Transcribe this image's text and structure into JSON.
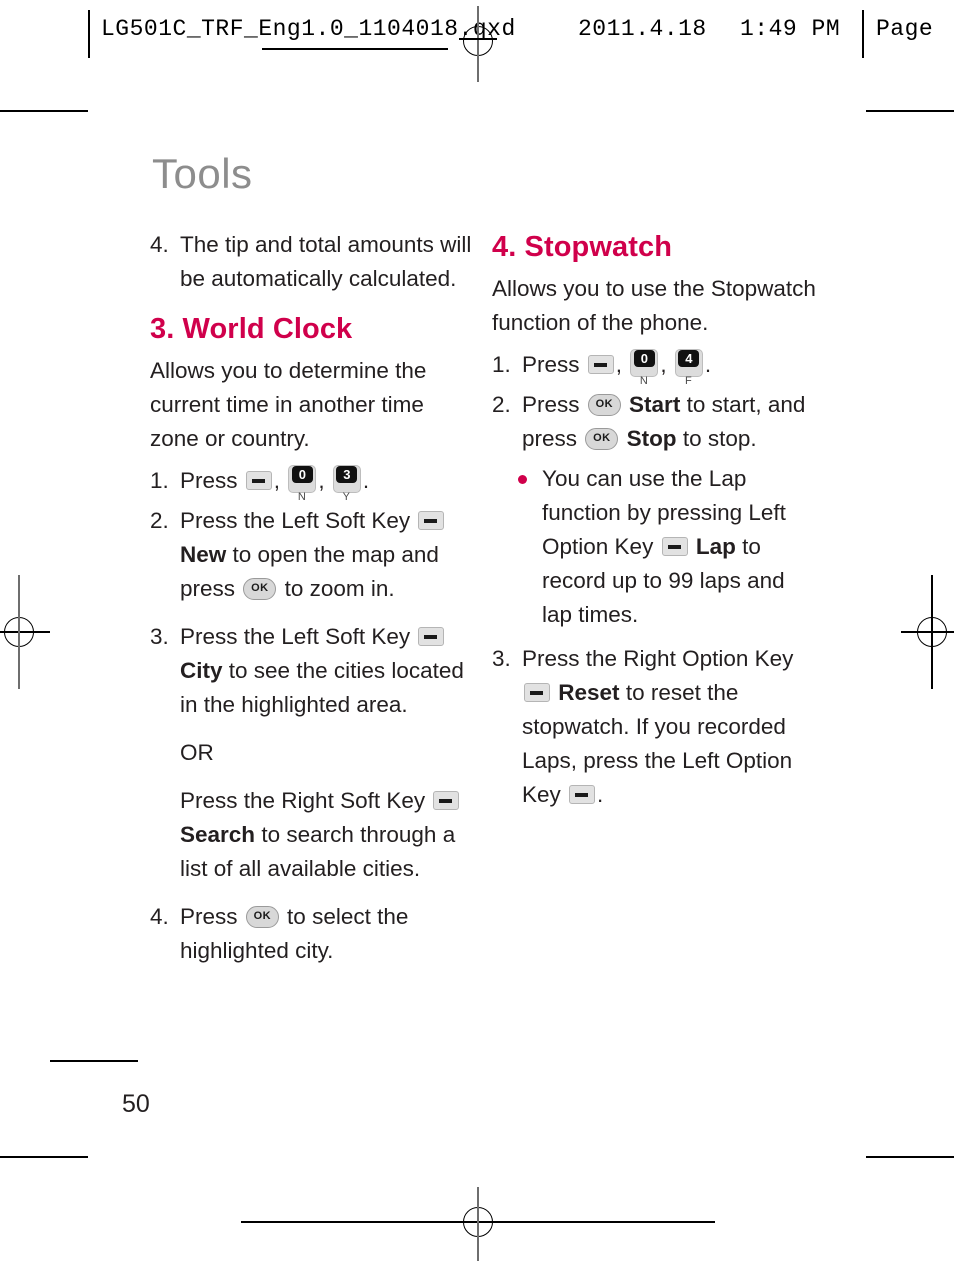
{
  "print_header": {
    "file": "LG501C_TRF_Eng1.0_1104018.qxd",
    "date": "2011.4.18",
    "time": "1:49 PM",
    "page_label": "Page"
  },
  "page": {
    "title": "Tools",
    "number": "50",
    "accent_color": "#d0004b",
    "title_color": "#8d8d8d"
  },
  "left_column": {
    "carryover_step": {
      "num": "4.",
      "text": "The tip and total amounts will be automatically calculated."
    },
    "section": {
      "heading": "3. World Clock",
      "intro": "Allows you to determine the current time in another time zone or country.",
      "steps": [
        {
          "num": "1.",
          "pre": "Press",
          "keys": [
            "soft-key-icon",
            "key-0-N-icon",
            "key-3-Y-icon"
          ],
          "post": "."
        },
        {
          "num": "2.",
          "pre": "Press the Left Soft Key",
          "key": "soft-key-icon",
          "bold": "New",
          "mid": "to open the map and press",
          "key2": "ok-key-icon",
          "post": "to zoom in."
        },
        {
          "num": "3.",
          "pre": "Press the Left Soft Key",
          "key": "soft-key-icon",
          "bold": "City",
          "post": "to see the cities located in the highlighted area."
        }
      ],
      "or_label": "OR",
      "or_step": {
        "pre": "Press the Right Soft Key",
        "key": "soft-key-icon",
        "bold": "Search",
        "post": "to search through a list of all available cities."
      },
      "final_step": {
        "num": "4.",
        "pre": "Press",
        "key": "ok-key-icon",
        "post": "to select the highlighted city."
      }
    }
  },
  "right_column": {
    "section": {
      "heading": "4. Stopwatch",
      "intro": "Allows you to use the Stopwatch function of the phone.",
      "steps": [
        {
          "num": "1.",
          "pre": "Press",
          "keys": [
            "soft-key-icon",
            "key-0-N-icon",
            "key-4-F-icon"
          ],
          "post": "."
        },
        {
          "num": "2.",
          "pre": "Press",
          "key": "ok-key-icon",
          "bold": "Start",
          "mid": "to start, and press",
          "key2": "ok-key-icon",
          "bold2": "Stop",
          "post": "to stop."
        },
        {
          "num": "3.",
          "pre": "Press the Right Option Key",
          "key": "soft-key-icon",
          "bold": "Reset",
          "mid": "to reset the stopwatch. If you recorded Laps, press the Left Option Key",
          "key2": "soft-key-icon",
          "post": "."
        }
      ],
      "bullets": [
        {
          "pre": "You can use the Lap function by pressing Left Option Key",
          "key": "soft-key-icon",
          "bold": "Lap",
          "post": "to record up to 99 laps and lap times."
        }
      ]
    }
  },
  "keys": {
    "soft_dash": "–",
    "ok_label": "OK",
    "key_0_digit": "0",
    "key_0_letters": "N",
    "key_3_digit": "3",
    "key_3_letters": "Y",
    "key_4_digit": "4",
    "key_4_letters": "F"
  }
}
